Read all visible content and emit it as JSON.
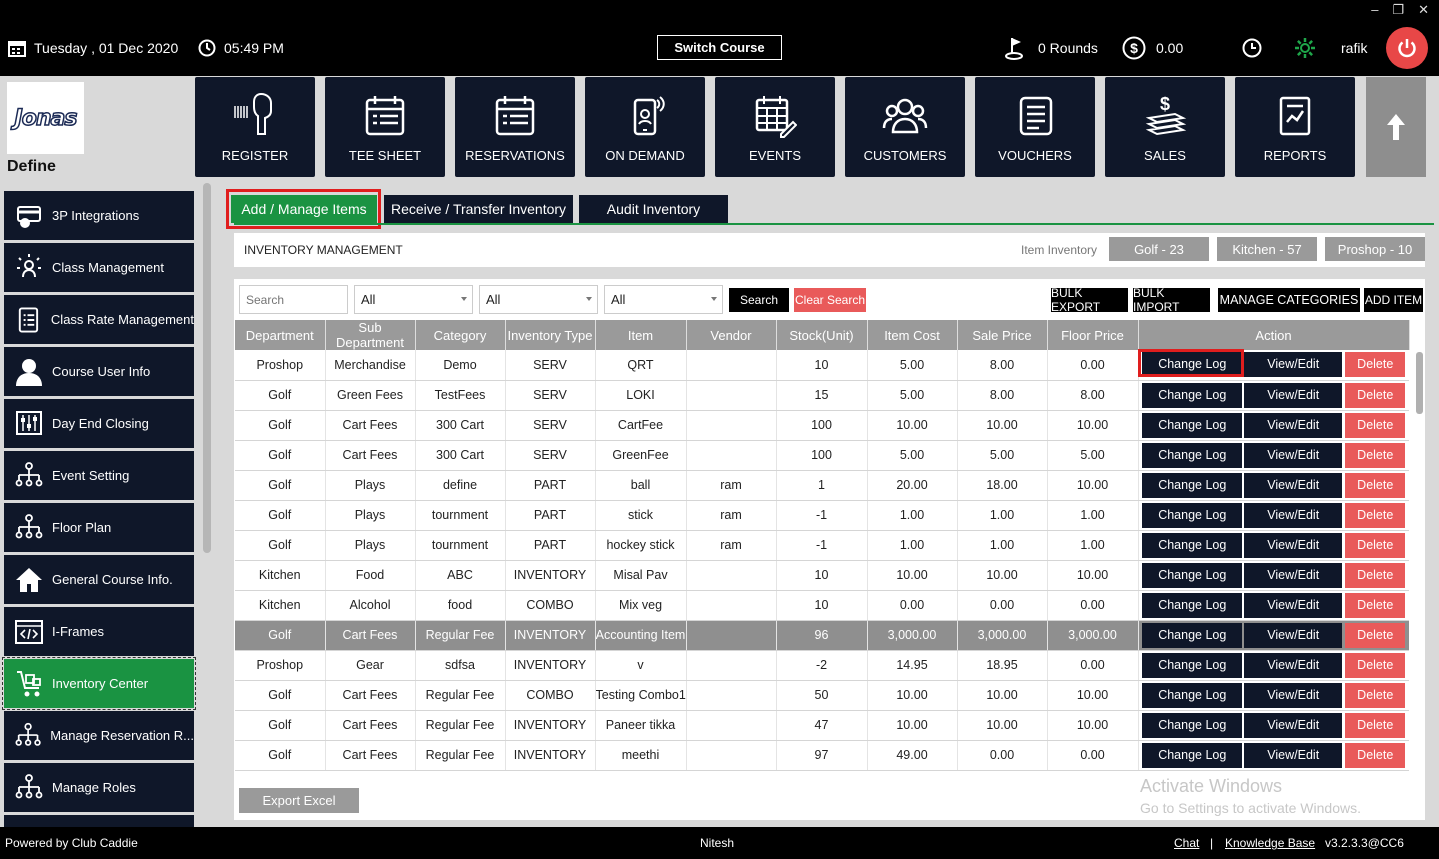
{
  "window": {
    "minimize": "‒",
    "restore": "❐",
    "close": "✕"
  },
  "topbar": {
    "date": "Tuesday ,  01 Dec 2020",
    "time": "05:49 PM",
    "switch_course": "Switch Course",
    "rounds": "0 Rounds",
    "amount": "0.00",
    "user": "rafik"
  },
  "logo": {
    "text": "Jonas"
  },
  "define_label": "Define",
  "tiles": [
    "REGISTER",
    "TEE SHEET",
    "RESERVATIONS",
    "ON DEMAND",
    "EVENTS",
    "CUSTOMERS",
    "VOUCHERS",
    "SALES",
    "REPORTS"
  ],
  "sidebar": [
    "3P Integrations",
    "Class Management",
    "Class Rate Management",
    "Course User Info",
    "Day End Closing",
    "Event Setting",
    "Floor Plan",
    "General Course Info.",
    "I-Frames",
    "Inventory Center",
    "Manage Reservation R...",
    "Manage Roles"
  ],
  "tabs": [
    "Add / Manage Items",
    "Receive / Transfer Inventory",
    "Audit Inventory"
  ],
  "inventory": {
    "title": "INVENTORY MANAGEMENT",
    "item_inventory_label": "Item Inventory",
    "pills": [
      "Golf - 23",
      "Kitchen - 57",
      "Proshop - 10"
    ]
  },
  "filters": {
    "search_placeholder": "Search",
    "select1": "All",
    "select2": "All",
    "select3": "All",
    "search_btn": "Search",
    "clear_btn": "Clear Search",
    "bulk_export": "BULK EXPORT",
    "bulk_import": "BULK IMPORT",
    "manage_categories": "MANAGE CATEGORIES",
    "add_item": "ADD ITEM"
  },
  "table": {
    "headers": [
      "Department",
      "Sub Department",
      "Category",
      "Inventory Type",
      "Item",
      "Vendor",
      "Stock(Unit)",
      "Item Cost",
      "Sale Price",
      "Floor Price",
      "Action"
    ],
    "action_labels": {
      "change_log": "Change Log",
      "view_edit": "View/Edit",
      "delete": "Delete"
    },
    "rows": [
      [
        "Proshop",
        "Merchandise",
        "Demo",
        "SERV",
        "QRT",
        "",
        "10",
        "5.00",
        "8.00",
        "0.00"
      ],
      [
        "Golf",
        "Green Fees",
        "TestFees",
        "SERV",
        "LOKI",
        "",
        "15",
        "5.00",
        "8.00",
        "8.00"
      ],
      [
        "Golf",
        "Cart Fees",
        "300 Cart",
        "SERV",
        "CartFee",
        "",
        "100",
        "10.00",
        "10.00",
        "10.00"
      ],
      [
        "Golf",
        "Cart Fees",
        "300 Cart",
        "SERV",
        "GreenFee",
        "",
        "100",
        "5.00",
        "5.00",
        "5.00"
      ],
      [
        "Golf",
        "Plays",
        "define",
        "PART",
        "ball",
        "ram",
        "1",
        "20.00",
        "18.00",
        "10.00"
      ],
      [
        "Golf",
        "Plays",
        "tournment",
        "PART",
        "stick",
        "ram",
        "-1",
        "1.00",
        "1.00",
        "1.00"
      ],
      [
        "Golf",
        "Plays",
        "tournment",
        "PART",
        "hockey stick",
        "ram",
        "-1",
        "1.00",
        "1.00",
        "1.00"
      ],
      [
        "Kitchen",
        "Food",
        "ABC",
        "INVENTORY",
        "Misal Pav",
        "",
        "10",
        "10.00",
        "10.00",
        "10.00"
      ],
      [
        "Kitchen",
        "Alcohol",
        "food",
        "COMBO",
        "Mix veg",
        "",
        "10",
        "0.00",
        "0.00",
        "0.00"
      ],
      [
        "Golf",
        "Cart Fees",
        "Regular Fee",
        "INVENTORY",
        "Accounting Item",
        "",
        "96",
        "3,000.00",
        "3,000.00",
        "3,000.00"
      ],
      [
        "Proshop",
        "Gear",
        "sdfsa",
        "INVENTORY",
        "v",
        "",
        "-2",
        "14.95",
        "18.95",
        "0.00"
      ],
      [
        "Golf",
        "Cart Fees",
        "Regular Fee",
        "COMBO",
        "Testing Combo1",
        "",
        "50",
        "10.00",
        "10.00",
        "10.00"
      ],
      [
        "Golf",
        "Cart Fees",
        "Regular Fee",
        "INVENTORY",
        "Paneer tikka",
        "",
        "47",
        "10.00",
        "10.00",
        "10.00"
      ],
      [
        "Golf",
        "Cart Fees",
        "Regular Fee",
        "INVENTORY",
        "meethi",
        "",
        "97",
        "49.00",
        "0.00",
        "0.00"
      ]
    ]
  },
  "export_excel": "Export Excel",
  "watermark": {
    "line1": "Activate Windows",
    "line2": "Go to Settings to activate Windows."
  },
  "footer": {
    "powered": "Powered by Club Caddie",
    "user": "Nitesh",
    "chat": "Chat",
    "sep": "|",
    "kb": "Knowledge Base",
    "version": "v3.2.3.3@CC6"
  }
}
